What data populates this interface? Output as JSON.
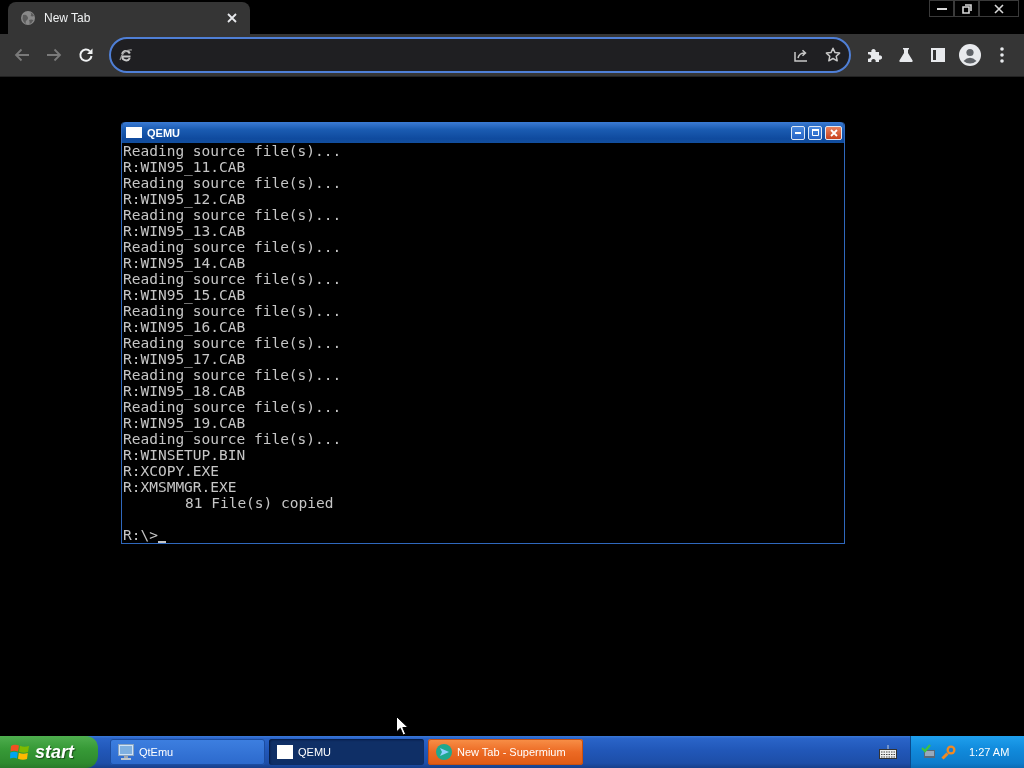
{
  "browser": {
    "tabs": [
      {
        "title": "New Tab",
        "selected": true
      }
    ],
    "nav_buttons": [
      {
        "kind": "back",
        "disabled": true
      },
      {
        "kind": "forward",
        "disabled": true
      },
      {
        "kind": "reload",
        "disabled": false
      }
    ],
    "address_bar": {
      "focused": true
    }
  },
  "qemu_window": {
    "title": "QEMU",
    "console": [
      {
        "kind": "output",
        "text": "Reading source file(s)..."
      },
      {
        "kind": "output",
        "text": "R:WIN95_11.CAB"
      },
      {
        "kind": "output",
        "text": "Reading source file(s)..."
      },
      {
        "kind": "output",
        "text": "R:WIN95_12.CAB"
      },
      {
        "kind": "output",
        "text": "Reading source file(s)..."
      },
      {
        "kind": "output",
        "text": "R:WIN95_13.CAB"
      },
      {
        "kind": "output",
        "text": "Reading source file(s)..."
      },
      {
        "kind": "output",
        "text": "R:WIN95_14.CAB"
      },
      {
        "kind": "output",
        "text": "Reading source file(s)..."
      },
      {
        "kind": "output",
        "text": "R:WIN95_15.CAB"
      },
      {
        "kind": "output",
        "text": "Reading source file(s)..."
      },
      {
        "kind": "output",
        "text": "R:WIN95_16.CAB"
      },
      {
        "kind": "output",
        "text": "Reading source file(s)..."
      },
      {
        "kind": "output",
        "text": "R:WIN95_17.CAB"
      },
      {
        "kind": "output",
        "text": "Reading source file(s)..."
      },
      {
        "kind": "output",
        "text": "R:WIN95_18.CAB"
      },
      {
        "kind": "output",
        "text": "Reading source file(s)..."
      },
      {
        "kind": "output",
        "text": "R:WIN95_19.CAB"
      },
      {
        "kind": "output",
        "text": "Reading source file(s)..."
      },
      {
        "kind": "output",
        "text": "R:WINSETUP.BIN"
      },
      {
        "kind": "output",
        "text": "R:XCOPY.EXE"
      },
      {
        "kind": "output",
        "text": "R:XMSMMGR.EXE"
      },
      {
        "kind": "indented",
        "text": "81 File(s) copied"
      },
      {
        "kind": "blank"
      },
      {
        "kind": "prompt",
        "text": "R:\\>"
      }
    ]
  },
  "taskbar": {
    "start_label": "start",
    "tasks": [
      {
        "kind": "manager",
        "label": "QtEmu",
        "selected": false,
        "flashing": false
      },
      {
        "kind": "vm",
        "label": "QEMU",
        "selected": true,
        "flashing": false
      },
      {
        "kind": "browser",
        "label": "New Tab - Supermium",
        "selected": false,
        "flashing": true
      }
    ],
    "clock": "1:27 AM"
  }
}
